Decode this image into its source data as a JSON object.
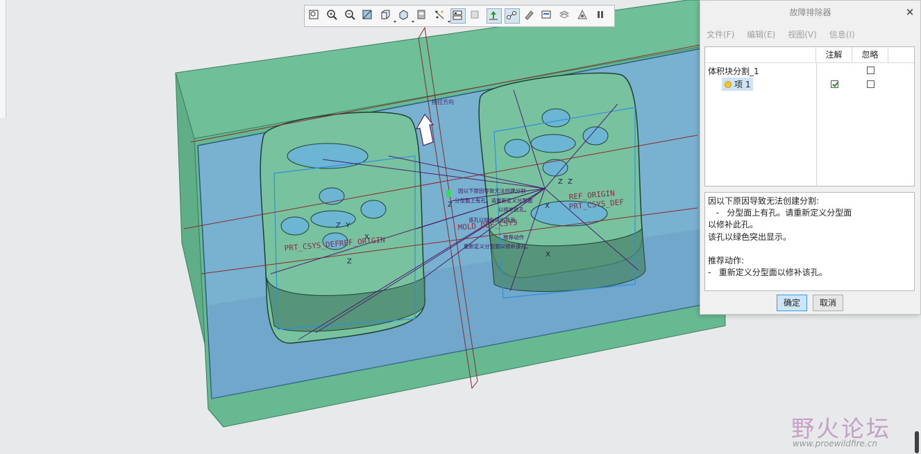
{
  "toolbar": {
    "buttons": [
      {
        "name": "refit-icon",
        "active": false
      },
      {
        "name": "zoom-in-icon",
        "active": false
      },
      {
        "name": "zoom-out-icon",
        "active": false
      },
      {
        "name": "repaint-icon",
        "active": false
      },
      {
        "name": "display-style-icon",
        "active": false,
        "dropdown": true
      },
      {
        "name": "saved-orientations-icon",
        "active": false,
        "dropdown": true
      },
      {
        "name": "view-manager-icon",
        "active": false
      },
      {
        "name": "perspective-icon",
        "active": false,
        "dropdown": true
      },
      {
        "name": "datum-display-filters-icon",
        "active": true
      },
      {
        "name": "annotation-display-icon",
        "active": false
      },
      {
        "name": "spin-center-icon",
        "active": true
      },
      {
        "name": "datum-points-icon",
        "active": true
      },
      {
        "name": "sketch-view-icon",
        "active": false
      },
      {
        "name": "section-display-icon",
        "active": false
      },
      {
        "name": "layers-icon",
        "active": false
      },
      {
        "name": "hidden-line-icon",
        "active": false
      },
      {
        "name": "pause-icon",
        "active": false
      }
    ]
  },
  "viewport": {
    "labels": {
      "pull_direction": "拖拉方向",
      "ref_origin_left": "PRT_CSYS_DEFREF_ORIGIN",
      "ref_origin_right": "REF_ORIGIN",
      "csys_right": "PRT_CSYS_DEF",
      "mold_csys": "MOLD_DEF_CSYS",
      "annotation_1": "因以下原因导致无法创建分割",
      "annotation_2": "分型面上有孔。请重新定义分型面",
      "annotation_3": "以修补此孔。",
      "annotation_4": "该孔以绿色突出显示。",
      "annotation_5": "推荐动作",
      "annotation_6": "重新定义分型面以修补该孔。",
      "axis_x": "X",
      "axis_y": "Y",
      "axis_z": "Z"
    }
  },
  "dialog": {
    "title": "故障排除器",
    "close_symbol": "×",
    "menu": [
      "文件(F)",
      "编辑(E)",
      "视图(V)",
      "信息(I)"
    ],
    "columns": {
      "note": "注解",
      "ignore": "忽略"
    },
    "tree": {
      "parent_label": "体积块分割_1",
      "parent_ignore": false,
      "item_label": "项 1",
      "item_note": true,
      "item_ignore": false
    },
    "description": [
      "因以下原因导致无法创建分割:",
      "   -   分型面上有孔。请重新定义分型面",
      "以修补此孔。",
      "该孔以绿色突出显示。",
      "",
      "推荐动作:",
      "-   重新定义分型面以修补该孔。"
    ],
    "ok_label": "确定",
    "cancel_label": "取消"
  },
  "watermark": {
    "title": "野火论坛",
    "url": "www.proewildfire.cn"
  },
  "colors": {
    "workpiece_green": "#67b992",
    "parting_blue": "#7ab1d6",
    "wire_purple": "#4a1f6e",
    "datum_red": "#8a2a2a",
    "primary_button": "#cce4f7"
  }
}
